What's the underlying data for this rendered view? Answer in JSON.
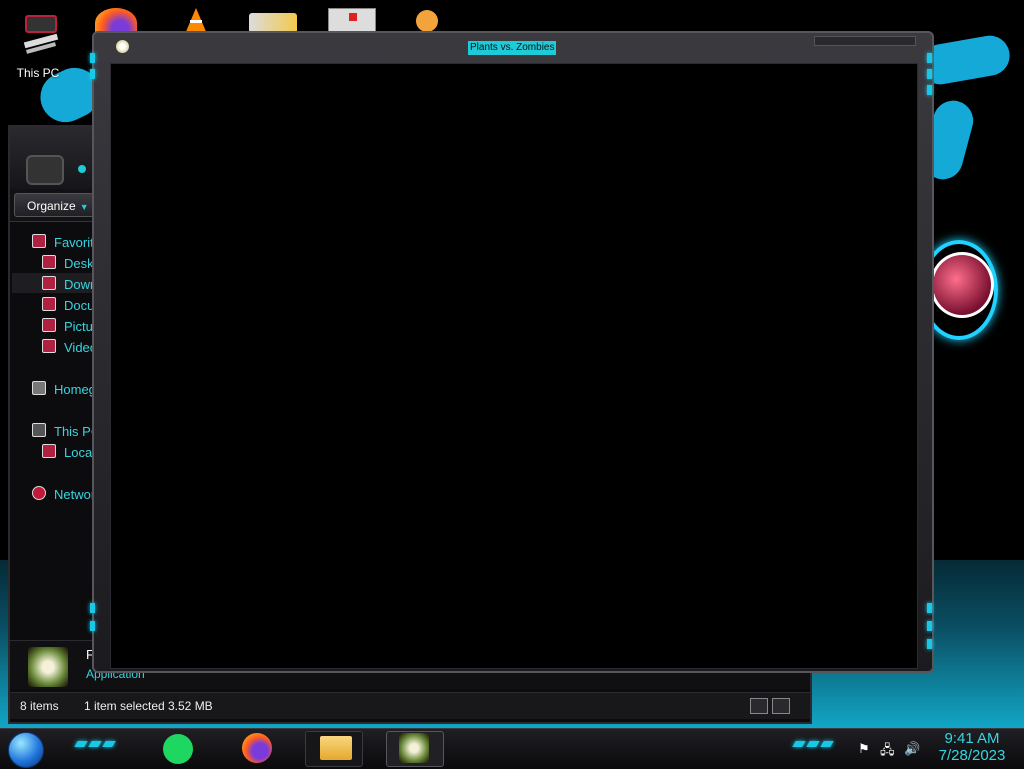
{
  "desktop": {
    "icons": [
      {
        "label": "This PC"
      }
    ]
  },
  "explorer": {
    "organize_label": "Organize",
    "nav": [
      {
        "label": "Favorite",
        "icon": "star-icon"
      },
      {
        "label": "Deskto",
        "icon": "desktop-icon"
      },
      {
        "label": "Downl",
        "icon": "downloads-icon"
      },
      {
        "label": "Docum",
        "icon": "documents-icon"
      },
      {
        "label": "Picture",
        "icon": "pictures-icon"
      },
      {
        "label": "Videos",
        "icon": "videos-icon"
      },
      {
        "label": "Homegr",
        "icon": "homegroup-icon"
      },
      {
        "label": "This PC",
        "icon": "computer-icon"
      },
      {
        "label": "Local I",
        "icon": "drive-icon"
      },
      {
        "label": "Network",
        "icon": "network-icon"
      }
    ],
    "details": {
      "name_initial": "F",
      "type": "Application"
    },
    "status": {
      "items": "8 items",
      "selection": "1 item selected",
      "size": "3.52 MB"
    }
  },
  "game_window": {
    "title": "Plants vs. Zombies"
  },
  "taskbar": {
    "apps": [
      {
        "name": "Spotify",
        "icon": "spotify-icon"
      },
      {
        "name": "Firefox",
        "icon": "firefox-icon"
      },
      {
        "name": "File Explorer",
        "icon": "folder-icon"
      },
      {
        "name": "Plants vs. Zombies",
        "icon": "pvz-icon"
      }
    ],
    "clock": {
      "time": "9:41 AM",
      "date": "7/28/2023"
    },
    "tray": {
      "flag": "⚑",
      "network": "🖧",
      "volume": "🔊"
    }
  },
  "colors": {
    "accent": "#1ecbd9",
    "text_accent": "#35d6e0",
    "wallpaper_blue": "#14a9d6"
  }
}
